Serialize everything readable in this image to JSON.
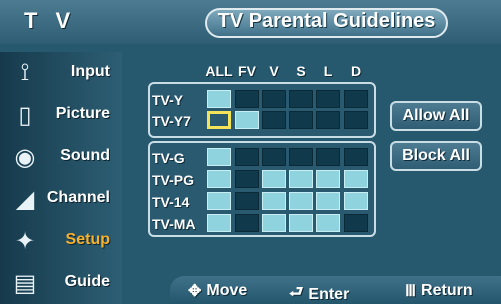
{
  "header": {
    "left_label": "T V",
    "title": "TV Parental Guidelines"
  },
  "sidebar": {
    "items": [
      {
        "label": "Input",
        "icon": "plug-icon",
        "glyph": "⟟"
      },
      {
        "label": "Picture",
        "icon": "picture-icon",
        "glyph": "▯"
      },
      {
        "label": "Sound",
        "icon": "speaker-icon",
        "glyph": "◉"
      },
      {
        "label": "Channel",
        "icon": "satellite-dish-icon",
        "glyph": "◢"
      },
      {
        "label": "Setup",
        "icon": "setup-icon",
        "glyph": "✦"
      },
      {
        "label": "Guide",
        "icon": "guide-icon",
        "glyph": "▤"
      }
    ],
    "active_item": "Setup"
  },
  "grid": {
    "columns": [
      "ALL",
      "FV",
      "V",
      "S",
      "L",
      "D"
    ],
    "rows": [
      {
        "label": "TV-Y",
        "states": [
          "on",
          "off",
          "off",
          "off",
          "off",
          "off"
        ]
      },
      {
        "label": "TV-Y7",
        "states": [
          "sel",
          "on",
          "off",
          "off",
          "off",
          "off"
        ]
      },
      {
        "label": "TV-G",
        "states": [
          "on",
          "off",
          "off",
          "off",
          "off",
          "off"
        ]
      },
      {
        "label": "TV-PG",
        "states": [
          "on",
          "off",
          "on",
          "on",
          "on",
          "on"
        ]
      },
      {
        "label": "TV-14",
        "states": [
          "on",
          "off",
          "on",
          "on",
          "on",
          "on"
        ]
      },
      {
        "label": "TV-MA",
        "states": [
          "on",
          "off",
          "on",
          "on",
          "on",
          "off"
        ]
      }
    ]
  },
  "buttons": {
    "allow_all": "Allow All",
    "block_all": "Block All"
  },
  "footer": {
    "move": "Move",
    "enter": "Enter",
    "return": "Return"
  },
  "colors": {
    "cell_on": "#8fd3df",
    "cell_off": "#10394b",
    "selection": "#f2e35b",
    "active_menu": "#f7b12a"
  }
}
